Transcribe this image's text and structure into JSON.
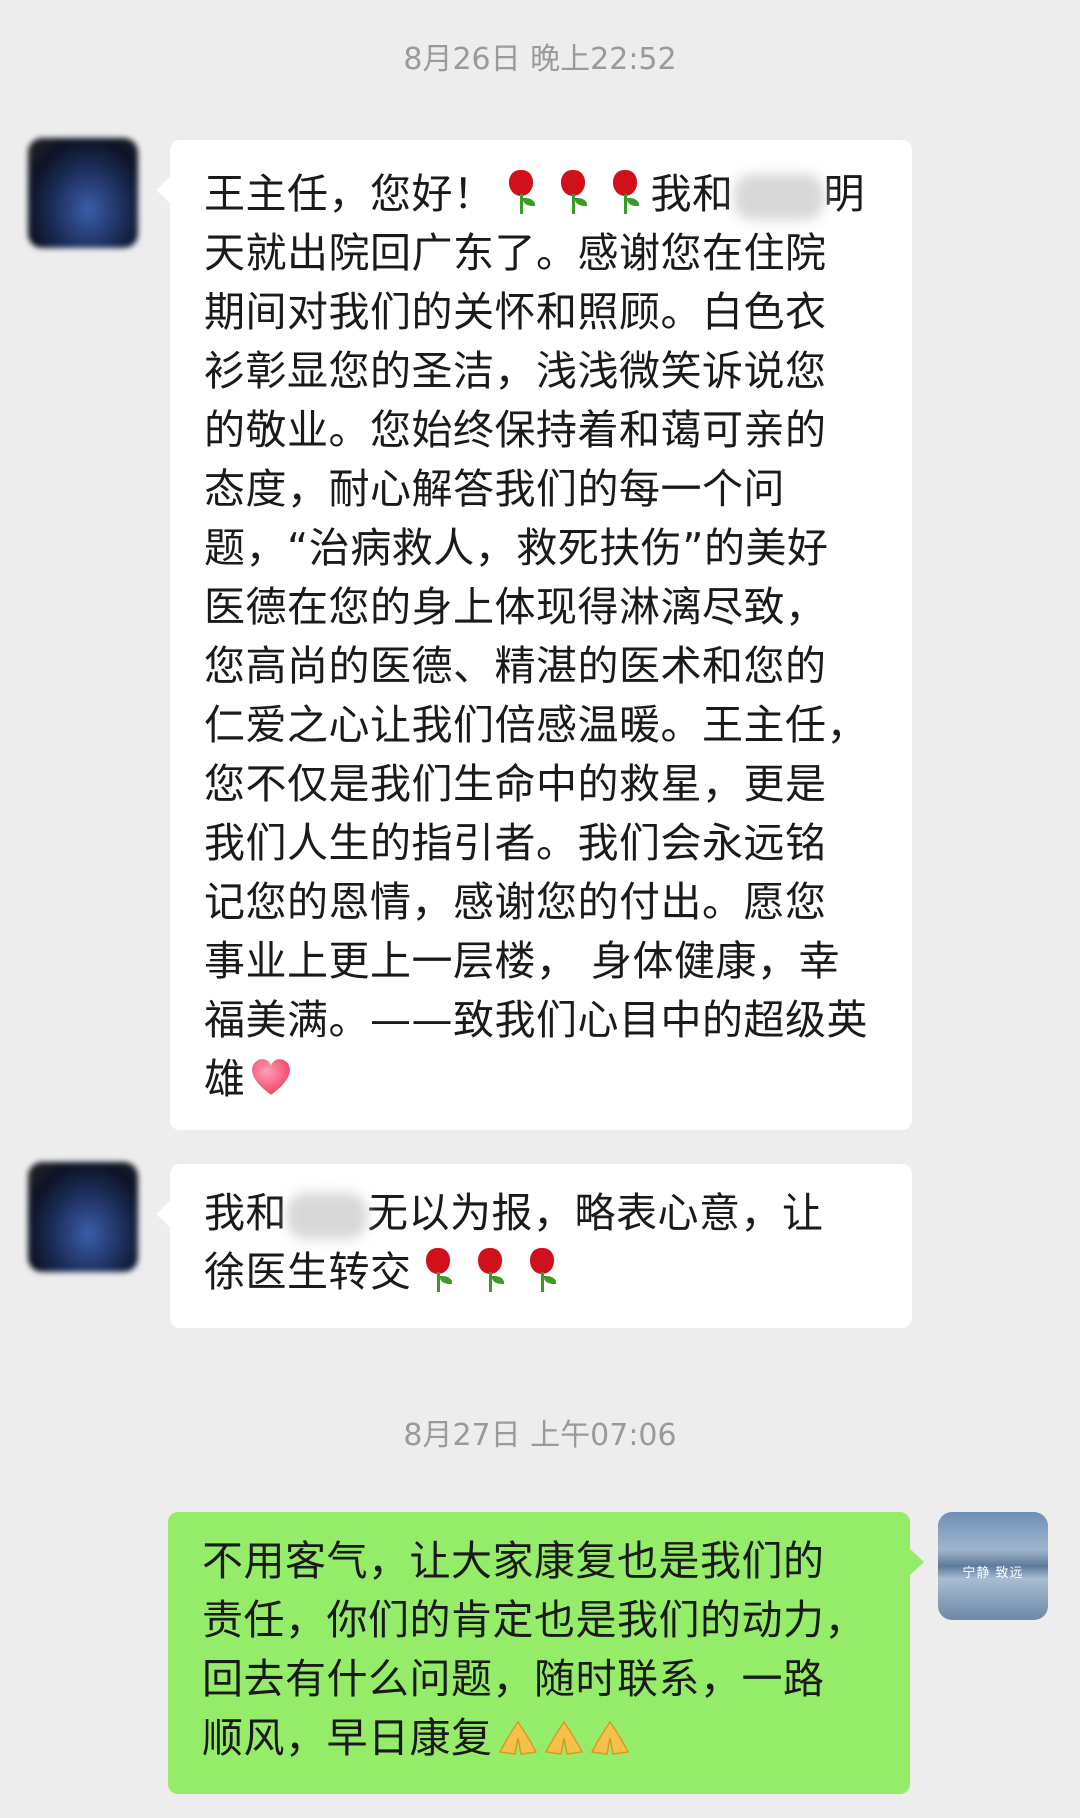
{
  "timestamps": [
    "8月26日 晚上22:52",
    "8月27日 上午07:06"
  ],
  "messages": {
    "m1": {
      "sender": "incoming",
      "lines": [
        "王主任，您好！",
        "我和",
        "明",
        "天就出院回广东了。感谢您在住院",
        "期间对我们的关怀和照顾。白色衣",
        "衫彰显您的圣洁，浅浅微笑诉说您",
        "的敬业。您始终保持着和蔼可亲的",
        "态度，耐心解答我们的每一个问",
        "题，“治病救人，救死扶伤”的美好",
        "医德在您的身上体现得淋漓尽致，",
        "您高尚的医德、精湛的医术和您的",
        "仁爱之心让我们倍感温暖。王主任，",
        "您不仅是我们生命中的救星，更是",
        "我们人生的指引者。我们会永远铭",
        "记您的恩情，感谢您的付出。愿您",
        "事业上更上一层楼， 身体健康，幸",
        "福美满。——致我们心目中的超级英",
        "雄"
      ]
    },
    "m2": {
      "sender": "incoming",
      "lines": [
        "我和",
        "无以为报，略表心意，让",
        "徐医生转交"
      ]
    },
    "m3": {
      "sender": "outgoing",
      "lines": [
        "不用客气，让大家康复也是我们的",
        "责任，你们的肯定也是我们的动力，",
        "回去有什么问题，随时联系，一路",
        "顺风，早日康复"
      ]
    }
  },
  "avatar_caption": "宁静 致远",
  "emoji": {
    "rose": "rose-icon",
    "heart": "heart-icon",
    "pray": "pray-icon"
  },
  "colors": {
    "background": "#ededed",
    "incoming_bubble": "#ffffff",
    "outgoing_bubble": "#95ec69"
  }
}
